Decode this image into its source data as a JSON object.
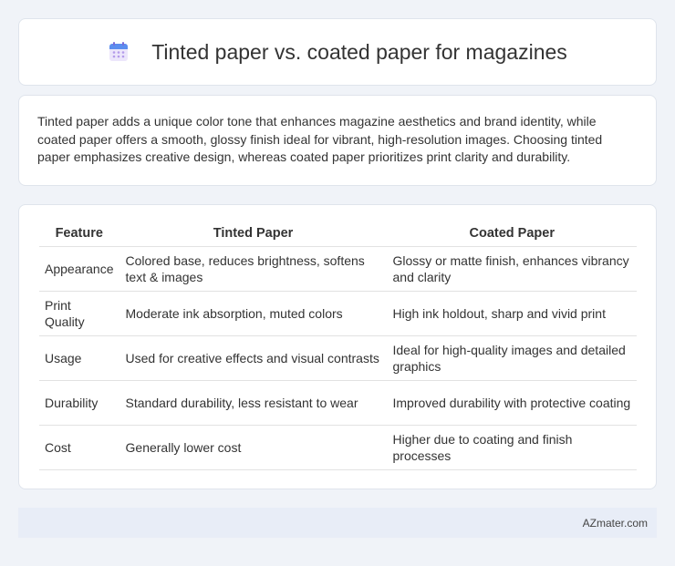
{
  "header": {
    "icon": "calendar-icon",
    "title": "Tinted paper vs. coated paper for magazines"
  },
  "summary": {
    "text": "Tinted paper adds a unique color tone that enhances magazine aesthetics and brand identity, while coated paper offers a smooth, glossy finish ideal for vibrant, high-resolution images. Choosing tinted paper emphasizes creative design, whereas coated paper prioritizes print clarity and durability."
  },
  "table": {
    "headers": [
      "Feature",
      "Tinted Paper",
      "Coated Paper"
    ],
    "rows": [
      [
        "Appearance",
        "Colored base, reduces brightness, softens text & images",
        "Glossy or matte finish, enhances vibrancy and clarity"
      ],
      [
        "Print Quality",
        "Moderate ink absorption, muted colors",
        "High ink holdout, sharp and vivid print"
      ],
      [
        "Usage",
        "Used for creative effects and visual contrasts",
        "Ideal for high-quality images and detailed graphics"
      ],
      [
        "Durability",
        "Standard durability, less resistant to wear",
        "Improved durability with protective coating"
      ],
      [
        "Cost",
        "Generally lower cost",
        "Higher due to coating and finish processes"
      ]
    ]
  },
  "footer": {
    "text": "AZmater.com"
  },
  "colors": {
    "background": "#f0f3f8",
    "card": "#ffffff",
    "footer": "#e8edf7",
    "icon_accent": "#5b8def",
    "icon_secondary": "#b49bea"
  }
}
